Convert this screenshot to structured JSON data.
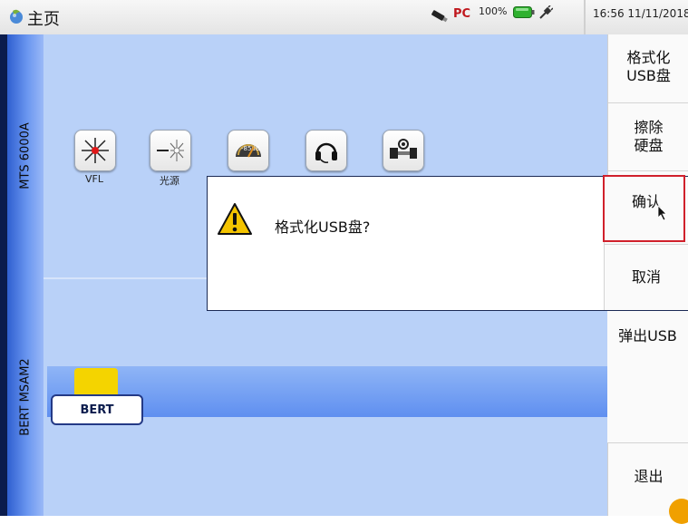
{
  "header": {
    "title": "主页",
    "battery_percent": "100%",
    "pc_indicator": "PC",
    "time": "16:56",
    "date": "11/11/2018",
    "icons": [
      "home-icon",
      "usb-stick-icon",
      "pc-connection-icon",
      "battery-icon",
      "power-plug-icon"
    ]
  },
  "modules": {
    "top_tab": "MTS 6000A",
    "bottom_tab": "BERT MSAM2"
  },
  "tools": [
    {
      "label": "VFL",
      "icon": "vfl-laser-icon"
    },
    {
      "label": "光源",
      "icon": "light-source-icon"
    },
    {
      "label": "",
      "icon": "power-meter-icon"
    },
    {
      "label": "",
      "icon": "talkset-headset-icon"
    },
    {
      "label": "",
      "icon": "fiber-inspection-icon"
    }
  ],
  "bert_button": "BERT",
  "softkeys": {
    "format_usb": {
      "line1": "格式化",
      "line2": "USB盘"
    },
    "erase_disk": {
      "line1": "擦除",
      "line2": "硬盘"
    },
    "eject_usb": "弹出USB",
    "exit": "退出"
  },
  "dialog": {
    "message": "格式化USB盘?",
    "confirm": "确认",
    "cancel": "取消",
    "highlight_color": "#d0202b"
  }
}
